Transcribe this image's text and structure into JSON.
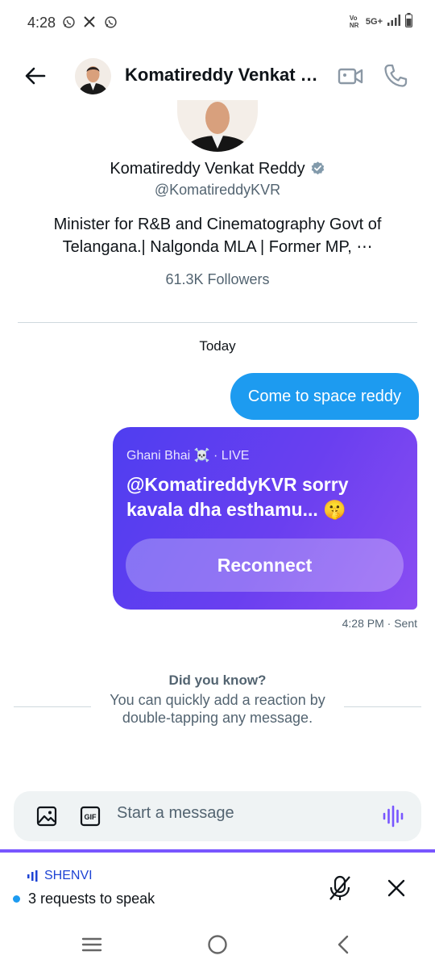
{
  "status_bar": {
    "time": "4:28",
    "left_icons": [
      "whatsapp-icon",
      "x-icon",
      "whatsapp-icon"
    ],
    "network": "5G+",
    "carrier": "Vo NR"
  },
  "header": {
    "title": "Komatireddy Venkat …",
    "icons": [
      "back-arrow-icon",
      "video-camera-icon",
      "phone-icon"
    ]
  },
  "profile": {
    "name": "Komatireddy Venkat Reddy",
    "handle": "@KomatireddyKVR",
    "bio": "Minister for R&B and Cinematography Govt of Telangana.| Nalgonda MLA | Former MP, ⋯",
    "followers": "61.3K Followers",
    "verified_color": "#829aab"
  },
  "conversation": {
    "day_label": "Today",
    "outgoing_message": "Come to space reddy",
    "space_card": {
      "host": "Ghani Bhai ☠️ · LIVE",
      "title": "@KomatireddyKVR sorry kavala dha esthamu... 🤫",
      "button": "Reconnect"
    },
    "meta": "4:28 PM · Sent"
  },
  "tip": {
    "title": "Did you know?",
    "body": "You can quickly add a reaction by double-tapping any message."
  },
  "composer": {
    "placeholder": "Start a message",
    "icons": [
      "image-icon",
      "gif-icon",
      "voice-wave-icon"
    ]
  },
  "space_dock": {
    "name": "SHENVI",
    "requests": "3 requests to speak",
    "accent": "#7856ff"
  },
  "colors": {
    "accent_blue": "#1d9bf0",
    "card_gradient_start": "#4f3ef0",
    "card_gradient_end": "#8a4df2",
    "muted_text": "#536471"
  }
}
